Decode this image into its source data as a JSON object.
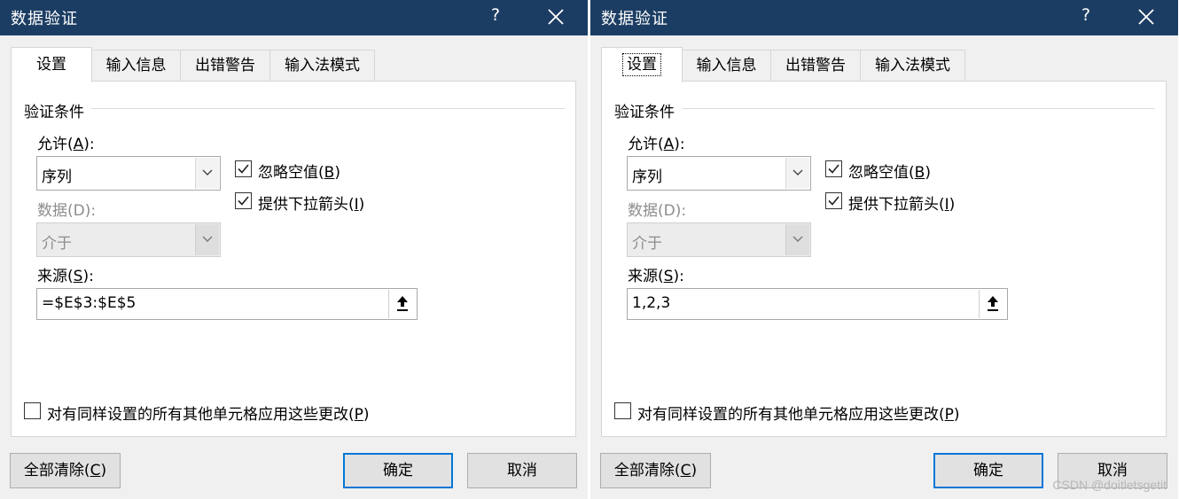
{
  "dialogs": [
    {
      "title": "数据验证",
      "help_label": "?",
      "tabs": [
        {
          "label": "设置",
          "active": true
        },
        {
          "label": "输入信息"
        },
        {
          "label": "出错警告"
        },
        {
          "label": "输入法模式"
        }
      ],
      "group_label": "验证条件",
      "allow": {
        "label_prefix": "允许(",
        "label_key": "A",
        "label_suffix": "):",
        "value": "序列"
      },
      "data": {
        "label": "数据(D):",
        "value": "介于"
      },
      "ignore_blank": {
        "label_prefix": "忽略空值(",
        "label_key": "B",
        "label_suffix": ")",
        "checked": true
      },
      "dropdown_arrow": {
        "label_prefix": "提供下拉箭头(",
        "label_key": "I",
        "label_suffix": ")",
        "checked": true
      },
      "source": {
        "label_prefix": "来源(",
        "label_key": "S",
        "label_suffix": "):",
        "value": "=$E$3:$E$5"
      },
      "apply_all": {
        "label_prefix": "对有同样设置的所有其他单元格应用这些更改(",
        "label_key": "P",
        "label_suffix": ")",
        "checked": false
      },
      "buttons": {
        "clear_prefix": "全部清除(",
        "clear_key": "C",
        "clear_suffix": ")",
        "ok": "确定",
        "cancel": "取消"
      }
    },
    {
      "title": "数据验证",
      "help_label": "?",
      "tabs": [
        {
          "label": "设置",
          "active": true,
          "focused": true
        },
        {
          "label": "输入信息"
        },
        {
          "label": "出错警告"
        },
        {
          "label": "输入法模式"
        }
      ],
      "group_label": "验证条件",
      "allow": {
        "label_prefix": "允许(",
        "label_key": "A",
        "label_suffix": "):",
        "value": "序列"
      },
      "data": {
        "label": "数据(D):",
        "value": "介于"
      },
      "ignore_blank": {
        "label_prefix": "忽略空值(",
        "label_key": "B",
        "label_suffix": ")",
        "checked": true
      },
      "dropdown_arrow": {
        "label_prefix": "提供下拉箭头(",
        "label_key": "I",
        "label_suffix": ")",
        "checked": true
      },
      "source": {
        "label_prefix": "来源(",
        "label_key": "S",
        "label_suffix": "):",
        "value": "1,2,3"
      },
      "apply_all": {
        "label_prefix": "对有同样设置的所有其他单元格应用这些更改(",
        "label_key": "P",
        "label_suffix": ")",
        "checked": false
      },
      "buttons": {
        "clear_prefix": "全部清除(",
        "clear_key": "C",
        "clear_suffix": ")",
        "ok": "确定",
        "cancel": "取消"
      }
    }
  ],
  "watermark": "CSDN @doitletsgetit",
  "colors": {
    "titlebar": "#1c3d63",
    "dialog_bg": "#f0f0f0",
    "default_button_border": "#0078d7"
  },
  "icons": {
    "close": "close-icon",
    "checkmark": "checkmark-icon",
    "dropdown": "chevron-down-icon",
    "collapse": "collapse-dialog-icon"
  }
}
